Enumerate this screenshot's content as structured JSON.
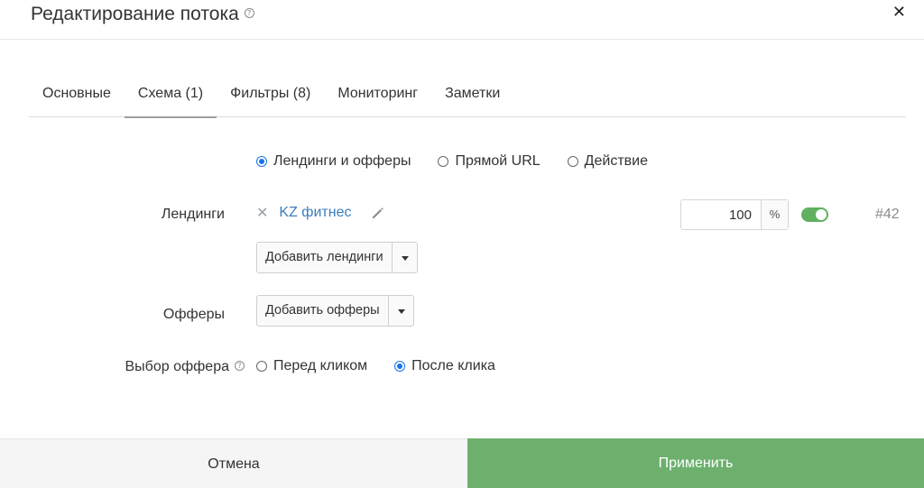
{
  "header": {
    "title": "Редактирование потока",
    "help_symbol": "?",
    "close_symbol": "✕"
  },
  "tabs": [
    {
      "label": "Основные",
      "active": false
    },
    {
      "label": "Схема (1)",
      "active": true
    },
    {
      "label": "Фильтры (8)",
      "active": false
    },
    {
      "label": "Мониторинг",
      "active": false
    },
    {
      "label": "Заметки",
      "active": false
    }
  ],
  "scheme_type": {
    "options": [
      {
        "label": "Лендинги и офферы",
        "checked": true
      },
      {
        "label": "Прямой URL",
        "checked": false
      },
      {
        "label": "Действие",
        "checked": false
      }
    ]
  },
  "landings": {
    "label": "Лендинги",
    "remove_symbol": "✕",
    "item": {
      "name": "KZ фитнес",
      "weight": "100",
      "weight_unit": "%",
      "enabled": true,
      "id": "#42"
    },
    "add_button": "Добавить лендинги"
  },
  "offers": {
    "label": "Офферы",
    "add_button": "Добавить офферы"
  },
  "offer_choice": {
    "label": "Выбор оффера",
    "help_symbol": "?",
    "options": [
      {
        "label": "Перед кликом",
        "checked": false
      },
      {
        "label": "После клика",
        "checked": true
      }
    ]
  },
  "footer": {
    "cancel": "Отмена",
    "apply": "Применить"
  },
  "colors": {
    "accent": "#1a73e8",
    "apply_button": "#6db06e",
    "toggle_on": "#5fb160",
    "link": "#3b7dbf"
  },
  "icons": {
    "help": "help-circle-icon",
    "close": "close-icon",
    "remove": "remove-icon",
    "edit": "pencil-icon",
    "dropdown": "caret-down-icon"
  }
}
